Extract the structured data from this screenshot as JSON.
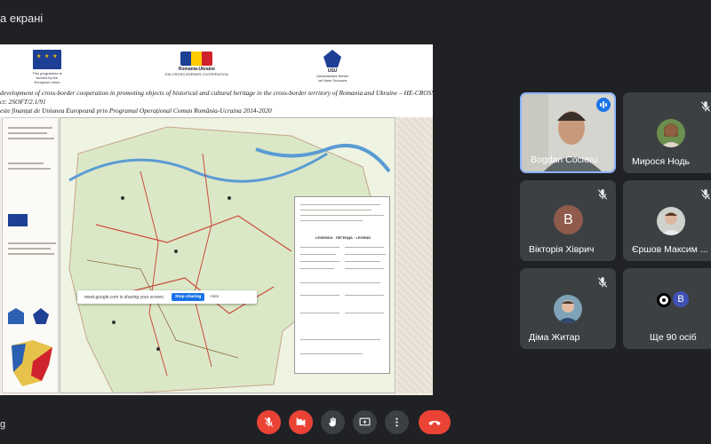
{
  "window": {
    "title": "а екрані"
  },
  "slide": {
    "logos": {
      "eu_caption": "This programme is funded by the European Union",
      "ro_ua_caption": "Romania-Ukraine",
      "ro_ua_sub": "ENI CROSS BORDER COOPERATION",
      "usu_caption": "USU",
      "usu_sub": "Universitatea Ștefan cel Mare Suceava"
    },
    "line1": "development of cross-border cooperation in promoting objects of historical and cultural heritage in the cross-border territory of Romania and Ukraine – HE-CROSS”",
    "line2": "ct: 2SOFT/2.1/91",
    "line3": "este finanțat de Uniunea Europeană prin Programul Operațional Comun România-Ucraina 2014-2020",
    "legend_title": "LEGENDA · ЛЕГЕНДА · LEGEND",
    "share_bar": {
      "message": "meet.google.com is sharing your screen.",
      "stop_label": "Stop sharing",
      "hide_label": "Hide"
    }
  },
  "participants": [
    {
      "name": "Bogdan Cocieru",
      "state": "speaking",
      "type": "video"
    },
    {
      "name": "Мирося Нодь",
      "state": "muted",
      "type": "photo"
    },
    {
      "name": "Вікторія Хіврич",
      "state": "muted",
      "type": "letter",
      "letter": "В",
      "color": "#8e5b4c"
    },
    {
      "name": "Єршов Максим ...",
      "state": "muted",
      "type": "photo"
    },
    {
      "name": "Діма Житар",
      "state": "muted",
      "type": "photo"
    },
    {
      "name": "Ще 90 осіб",
      "state": "more",
      "type": "group",
      "letter": "B"
    }
  ],
  "controls": {
    "left_label": "g",
    "colors": {
      "danger": "#ea4335",
      "neutral": "#3c4043",
      "accent": "#1a73e8"
    }
  }
}
